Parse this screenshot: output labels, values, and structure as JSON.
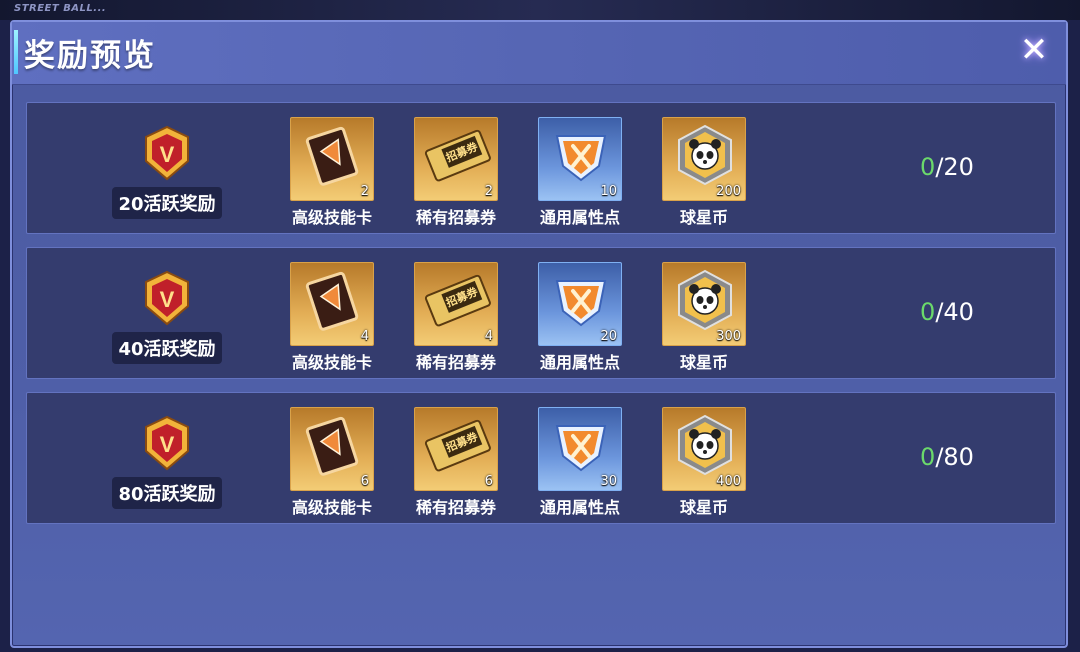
{
  "background": {
    "text": "STREET BALL..."
  },
  "dialog": {
    "title": "奖励预览",
    "close_label": "✕"
  },
  "colors": {
    "progress_current": "#6bd96b",
    "panel": "#4f5fa8",
    "row": "#343c6e",
    "gold_frame": "#e2ad55",
    "blue_frame": "#6b95dc"
  },
  "rows": [
    {
      "label": "20活跃奖励",
      "icon": "v-badge-icon",
      "items": [
        {
          "name": "高级技能卡",
          "count": "2",
          "icon": "skill-card-icon"
        },
        {
          "name": "稀有招募券",
          "count": "2",
          "icon": "recruit-ticket-icon"
        },
        {
          "name": "通用属性点",
          "count": "10",
          "icon": "attribute-point-icon"
        },
        {
          "name": "球星币",
          "count": "200",
          "icon": "panda-coin-icon"
        }
      ],
      "progress_current": "0",
      "progress_total": "/20"
    },
    {
      "label": "40活跃奖励",
      "icon": "v-badge-icon",
      "items": [
        {
          "name": "高级技能卡",
          "count": "4",
          "icon": "skill-card-icon"
        },
        {
          "name": "稀有招募券",
          "count": "4",
          "icon": "recruit-ticket-icon"
        },
        {
          "name": "通用属性点",
          "count": "20",
          "icon": "attribute-point-icon"
        },
        {
          "name": "球星币",
          "count": "300",
          "icon": "panda-coin-icon"
        }
      ],
      "progress_current": "0",
      "progress_total": "/40"
    },
    {
      "label": "80活跃奖励",
      "icon": "v-badge-icon",
      "items": [
        {
          "name": "高级技能卡",
          "count": "6",
          "icon": "skill-card-icon"
        },
        {
          "name": "稀有招募券",
          "count": "6",
          "icon": "recruit-ticket-icon"
        },
        {
          "name": "通用属性点",
          "count": "30",
          "icon": "attribute-point-icon"
        },
        {
          "name": "球星币",
          "count": "400",
          "icon": "panda-coin-icon"
        }
      ],
      "progress_current": "0",
      "progress_total": "/80"
    }
  ]
}
